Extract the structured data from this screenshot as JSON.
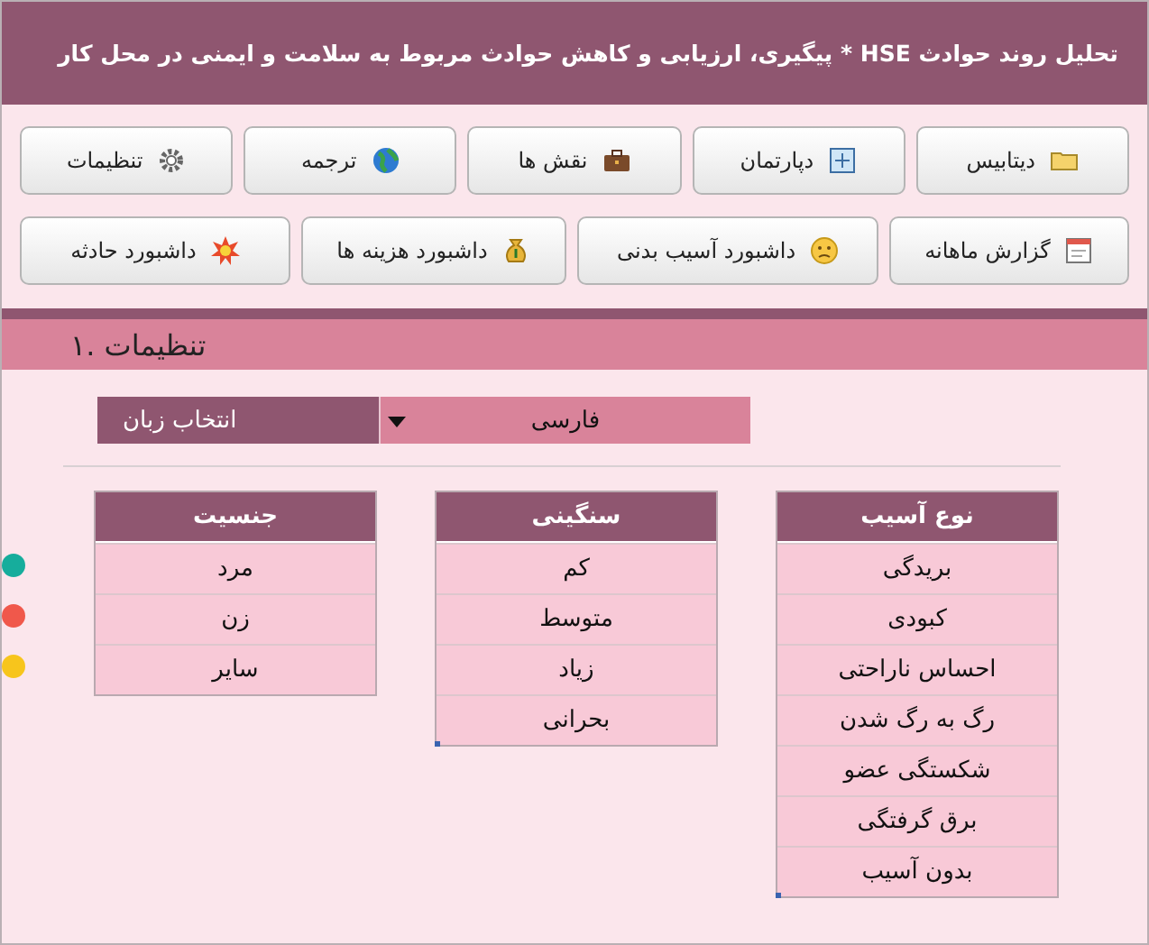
{
  "header": {
    "title": "تحلیل روند حوادث HSE * پیگیری، ارزیابی و کاهش حوادث مربوط به سلامت و ایمنی در محل کار"
  },
  "toolbar_rows": [
    [
      {
        "label": "دیتابیس"
      },
      {
        "label": "دپارتمان"
      },
      {
        "label": "نقش ها"
      },
      {
        "label": "ترجمه"
      },
      {
        "label": "تنظیمات"
      }
    ],
    [
      {
        "label": "گزارش ماهانه"
      },
      {
        "label": "داشبورد آسیب بدنی"
      },
      {
        "label": "داشبورد هزینه ها"
      },
      {
        "label": "داشبورد حادثه"
      }
    ]
  ],
  "section": {
    "title": "تنظیمات .۱"
  },
  "language": {
    "label": "انتخاب زبان",
    "value": "فارسی"
  },
  "tables": [
    {
      "heading": "نوع آسیب",
      "rows": [
        {
          "text": "بریدگی"
        },
        {
          "text": "کبودی"
        },
        {
          "text": "احساس ناراحتی"
        },
        {
          "text": "رگ به رگ شدن"
        },
        {
          "text": "شکستگی عضو"
        },
        {
          "text": "برق گرفتگی"
        },
        {
          "text": "بدون آسیب"
        }
      ]
    },
    {
      "heading": "سنگینی",
      "rows": [
        {
          "text": "کم"
        },
        {
          "text": "متوسط"
        },
        {
          "text": "زیاد"
        },
        {
          "text": "بحرانی"
        }
      ]
    },
    {
      "heading": "جنسیت",
      "rows": [
        {
          "text": "مرد",
          "color": "#16ad9c"
        },
        {
          "text": "زن",
          "color": "#f0584b"
        },
        {
          "text": "سایر",
          "color": "#f7c51c"
        }
      ]
    }
  ]
}
